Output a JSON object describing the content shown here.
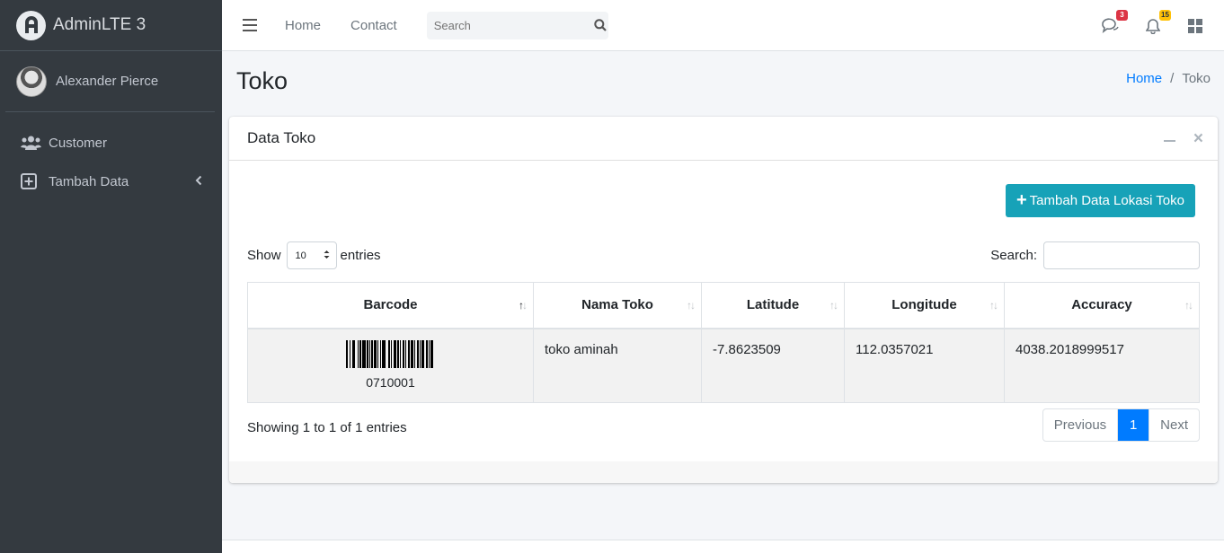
{
  "brand": {
    "name": "AdminLTE 3"
  },
  "user": {
    "name": "Alexander Pierce"
  },
  "sidebar": {
    "items": [
      {
        "label": "Customer",
        "icon": "users-icon"
      },
      {
        "label": "Tambah Data",
        "icon": "plus-square-icon"
      }
    ]
  },
  "navbar": {
    "links": [
      "Home",
      "Contact"
    ],
    "search_placeholder": "Search",
    "messages_badge": "3",
    "notifications_badge": "15"
  },
  "content": {
    "title": "Toko",
    "breadcrumb": [
      "Home",
      "Toko"
    ]
  },
  "card": {
    "title": "Data Toko",
    "add_button": "Tambah Data Lokasi Toko",
    "show_label": "Show",
    "entries_label": "entries",
    "page_length": "10",
    "search_label": "Search:",
    "columns": [
      "Barcode",
      "Nama Toko",
      "Latitude",
      "Longitude",
      "Accuracy"
    ],
    "rows": [
      {
        "barcode": "0710001",
        "nama_toko": "toko aminah",
        "latitude": "-7.8623509",
        "longitude": "112.0357021",
        "accuracy": "4038.2018999517"
      }
    ],
    "info": "Showing 1 to 1 of 1 entries",
    "pagination": {
      "previous": "Previous",
      "current": "1",
      "next": "Next"
    }
  },
  "colors": {
    "sidebar": "#343a40",
    "primary": "#007bff",
    "info": "#17a2b8",
    "danger": "#dc3545",
    "warning": "#ffc107"
  }
}
